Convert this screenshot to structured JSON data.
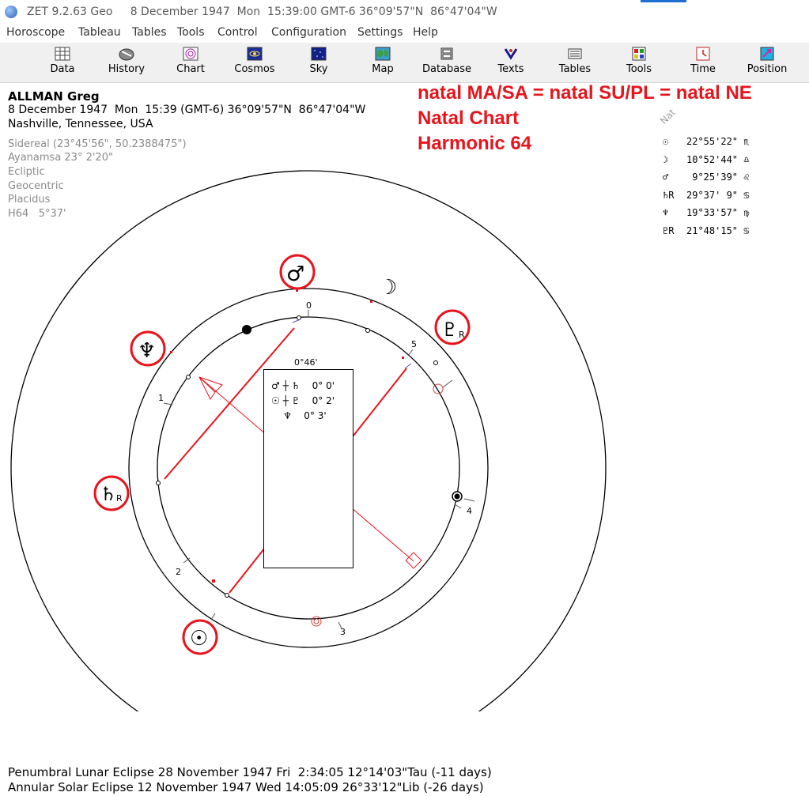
{
  "titlebar": {
    "title": "ZET 9.2.63 Geo     8 December 1947  Mon  15:39:00 GMT-6 36°09'57\"N  86°47'04\"W"
  },
  "menu": [
    "Horoscope",
    "Tableau",
    "Tables",
    "Tools",
    "Control",
    "Configuration",
    "Settings",
    "Help"
  ],
  "toolbar": [
    "Data",
    "History",
    "Chart",
    "Cosmos",
    "Sky",
    "Map",
    "Database",
    "Texts",
    "Tables",
    "Tools",
    "Time",
    "Position"
  ],
  "info": {
    "name": "ALLMAN Greg",
    "datetime": "8 December 1947  Mon  15:39 (GMT-6) 36°09'57\"N  86°47'04\"W",
    "place": "Nashville, Tennessee, USA",
    "sidereal": "Sidereal (23°45'56\", 50.2388475\")",
    "ayanamsa": "Ayanamsa 23° 2'20\"",
    "ecliptic": "Ecliptic",
    "geocentric": "Geocentric",
    "placidus": "Placidus",
    "harmonic": "H64   5°37'"
  },
  "red_titles": {
    "line1": "natal MA/SA = natal SU/PL = natal NE",
    "line2": "Natal Chart",
    "line3": "Harmonic 64"
  },
  "planet_list_label": "Nat",
  "planets": [
    {
      "sym": "☉",
      "pos": "22°55'22\"",
      "sign": "♏"
    },
    {
      "sym": "☽",
      "pos": "10°52'44\"",
      "sign": "♎"
    },
    {
      "sym": "♂",
      "pos": " 9°25'39\"",
      "sign": "♌"
    },
    {
      "sym": "♄R",
      "pos": "29°37' 9\"",
      "sign": "♋"
    },
    {
      "sym": "♆",
      "pos": "19°33'57\"",
      "sign": "♍"
    },
    {
      "sym": "♇R",
      "pos": "21°48'15\"",
      "sign": "♋"
    }
  ],
  "aspect_box": {
    "header": "0°46'",
    "rows": [
      {
        "left": "♂ ┼ ♄",
        "value": "0° 0'"
      },
      {
        "left": "☉ ┼ ♇",
        "value": "0° 2'"
      },
      {
        "left": "    ♆",
        "value": "0° 3'"
      }
    ]
  },
  "house_numbers": [
    "0",
    "1",
    "2",
    "3",
    "4",
    "5"
  ],
  "wheel_glyphs": {
    "mars": "♂",
    "moon": "☽",
    "pluto": "♇",
    "neptune": "♆",
    "saturn": "♄",
    "sun": "☉",
    "retro": "R"
  },
  "bottom": {
    "line1": "Penumbral Lunar Eclipse 28 November 1947 Fri  2:34:05 12°14'03\"Tau (-11 days)",
    "line2": "Annular Solar Eclipse 12 November 1947 Wed 14:05:09 26°33'12\"Lib (-26 days)"
  },
  "colors": {
    "highlight": "#e8141c",
    "aspect_line": "#e8141c"
  }
}
